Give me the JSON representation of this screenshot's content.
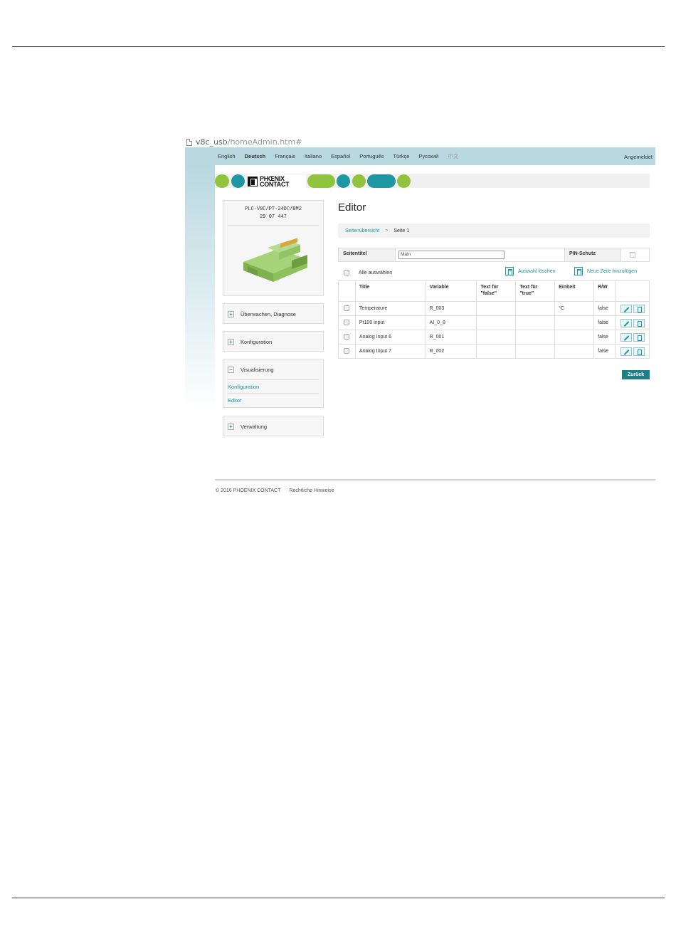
{
  "address_bar": {
    "path_prefix": "v8c_usb",
    "path_rest": "/homeAdmin.htm#"
  },
  "top_bar": {
    "languages": [
      "English",
      "Deutsch",
      "Français",
      "Italiano",
      "Español",
      "Português",
      "Türkçe",
      "Русский",
      "中文"
    ],
    "active_language": "Deutsch",
    "status": "Angemeldet"
  },
  "logo": {
    "line1": "PHŒNIX",
    "line2": "CONTACT"
  },
  "product": {
    "name": "PLC-V8C/PT-24DC/BM2",
    "number": "29 07 447"
  },
  "nav": {
    "monitor": "Überwachen, Diagnose",
    "config": "Konfiguration",
    "visual": "Visualisierung",
    "visual_sub": [
      "Konfiguration",
      "Editor"
    ],
    "admin": "Verwaltung"
  },
  "editor": {
    "title": "Editor",
    "breadcrumb_link": "Seitenübersicht",
    "breadcrumb_current": "Seite 1",
    "page_title_label": "Seitentitel",
    "page_title_value": "Main",
    "pin_label": "PIN-Schutz",
    "select_all": "Alle auswählen",
    "delete_selection": "Auswahl löschen",
    "add_row": "Neue Zeile hinzufügen",
    "columns": [
      "Title",
      "Variable",
      "Text für \"false\"",
      "Text für \"true\"",
      "Einheit",
      "R/W"
    ],
    "rows": [
      {
        "title": "Temperature",
        "variable": "R_003",
        "text_false": "",
        "text_true": "",
        "unit": "°C",
        "rw": "false"
      },
      {
        "title": "Pt100 input",
        "variable": "AI_0_8",
        "text_false": "",
        "text_true": "",
        "unit": "",
        "rw": "false"
      },
      {
        "title": "Analog Input 6",
        "variable": "R_001",
        "text_false": "",
        "text_true": "",
        "unit": "",
        "rw": "false"
      },
      {
        "title": "Analog Input 7",
        "variable": "R_002",
        "text_false": "",
        "text_true": "",
        "unit": "",
        "rw": "false"
      }
    ],
    "back_button": "Zurück"
  },
  "footer": {
    "copyright": "© 2016 PHOENIX CONTACT",
    "legal": "Rechtliche Hinweise"
  },
  "colors": {
    "brand_teal": "#1e97a3",
    "brand_green": "#8fc43c",
    "header_bg": "#b9d8e0"
  }
}
